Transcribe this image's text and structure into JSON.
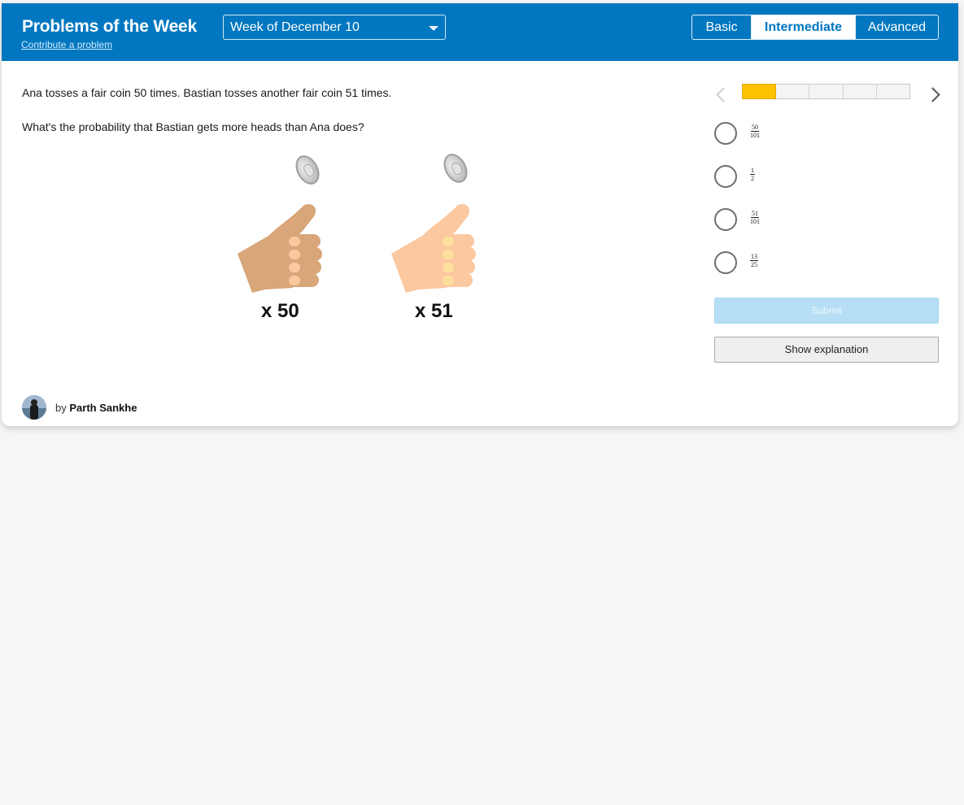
{
  "header": {
    "title": "Problems of the Week",
    "contribute_link": "Contribute a problem",
    "week_select": "Week of December 10",
    "levels": [
      "Basic",
      "Intermediate",
      "Advanced"
    ],
    "selected_level": "Intermediate",
    "bg_color": "#0077c0"
  },
  "problem": {
    "line1": "Ana tosses a fair coin 50 times. Bastian tosses another fair coin 51 times.",
    "line2": "What's the probability that Bastian gets more heads than Ana does?",
    "illustration": {
      "left_count": "x 50",
      "right_count": "x 51",
      "left_hand_color": "#d8a678",
      "right_hand_color": "#fcc8a0",
      "coin_icon": "coin-icon",
      "hand_icon": "thumbs-up-hand-icon"
    }
  },
  "progress": {
    "segments": 5,
    "current": 1,
    "active_color": "#ffc200"
  },
  "choices": [
    {
      "num": "50",
      "den": "101"
    },
    {
      "num": "1",
      "den": "2"
    },
    {
      "num": "51",
      "den": "101"
    },
    {
      "num": "13",
      "den": "25"
    }
  ],
  "buttons": {
    "submit": "Submit",
    "explanation": "Show explanation"
  },
  "author": {
    "prefix": "by",
    "name": "Parth Sankhe"
  }
}
